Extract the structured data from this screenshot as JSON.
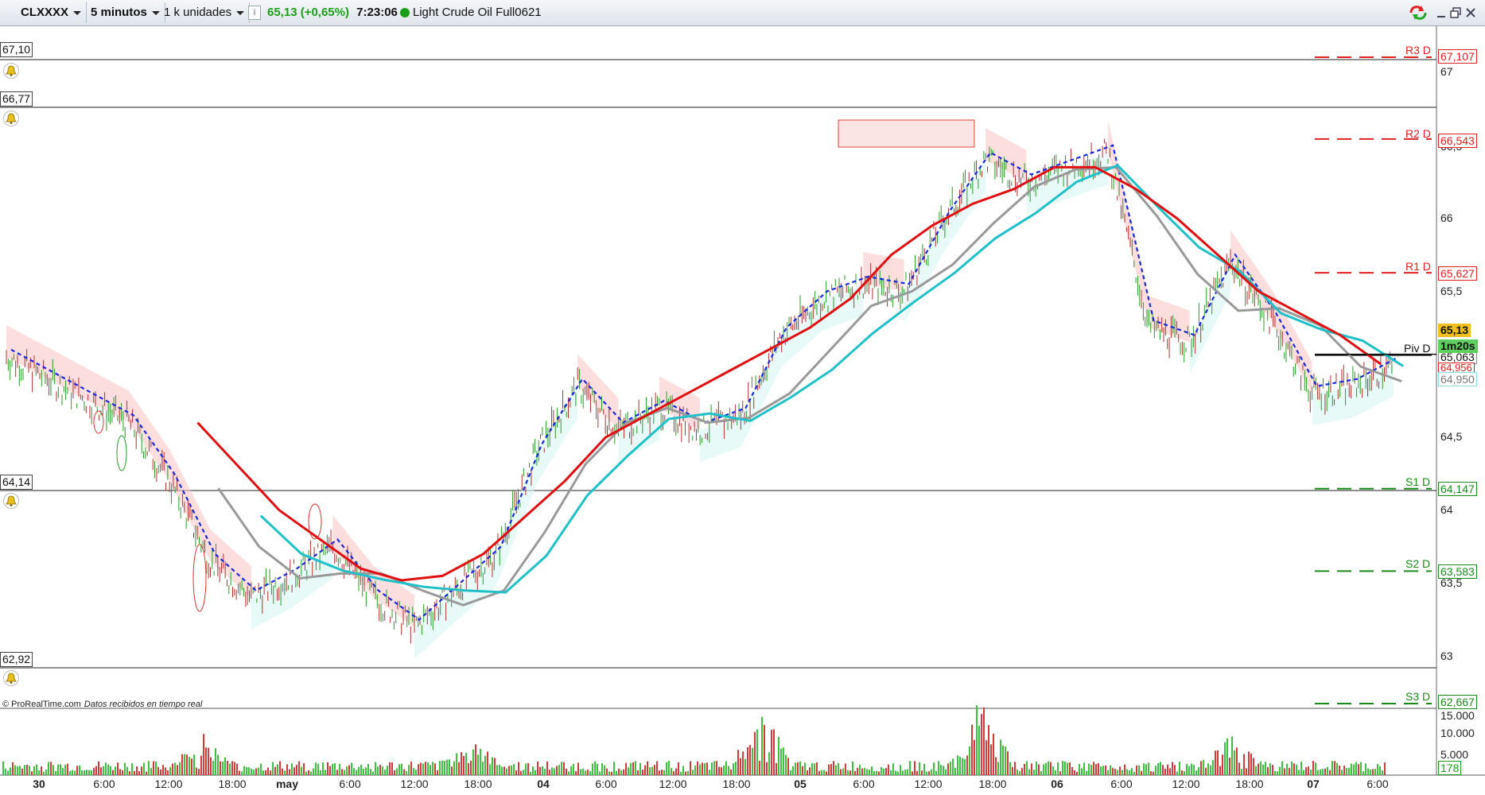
{
  "toolbar": {
    "symbol": "CLXXXX",
    "timeframe": "5 minutos",
    "units": "1 k unidades",
    "info_icon": "info-icon",
    "price_change": "65,13 (+0,65%)",
    "time": "7:23:06",
    "status_dot": "green-status-dot",
    "instrument": "Light Crude Oil Full0621",
    "window_icons": [
      "sync-icon",
      "minimize-icon",
      "restore-icon",
      "close-icon"
    ]
  },
  "credit": {
    "source": "© ProRealTime.com",
    "note": "Datos recibidos en tiempo real"
  },
  "alert_levels": [
    "67,10",
    "66,77",
    "64,14",
    "62,92"
  ],
  "current_price": {
    "value": "65,13",
    "countdown": "1m20s"
  },
  "colors": {
    "sma_red": "#e01010",
    "cyan_ma": "#20c0c8",
    "gray_ma": "#999999",
    "dash_blue": "#1a2ad8",
    "resistance": "#e02020",
    "support": "#1a8a1a",
    "price_tag": "#f0c020",
    "countdown_tag": "#5fd05f"
  },
  "chart_data": [
    {
      "type": "line",
      "title": "",
      "x_tick_labels": [
        "30",
        "6:00",
        "12:00",
        "18:00",
        "may",
        "6:00",
        "12:00",
        "18:00",
        "04",
        "6:00",
        "12:00",
        "18:00",
        "05",
        "6:00",
        "12:00",
        "18:00",
        "06",
        "6:00",
        "12:00",
        "18:00",
        "07",
        "6:00"
      ],
      "y_tick_labels": [
        "67",
        "66,5",
        "66",
        "65,5",
        "65",
        "64,5",
        "64",
        "63,5",
        "63"
      ],
      "ylim": [
        62.9,
        67.15
      ],
      "pivots": [
        {
          "label": "R3 D",
          "value": "67,107"
        },
        {
          "label": "R2 D",
          "value": "66,543"
        },
        {
          "label": "R1 D",
          "value": "65,627"
        },
        {
          "label": "Piv D",
          "value": "65,063"
        },
        {
          "label": "S1 D",
          "value": "64,147"
        },
        {
          "label": "S2 D",
          "value": "63,583"
        },
        {
          "label": "S3 D",
          "value": "62,667"
        }
      ],
      "extra_tags": [
        "64,950",
        "64,956"
      ],
      "series": [
        {
          "x": [
            0,
            6,
            12,
            18,
            24,
            30,
            36,
            42,
            48,
            54,
            60,
            66,
            72,
            78,
            84,
            90,
            96,
            102,
            108,
            114,
            120,
            126,
            132,
            138,
            144,
            150,
            156,
            162,
            168,
            174,
            180,
            186,
            192,
            198,
            204
          ],
          "values": [
            65.05,
            64.9,
            64.75,
            64.6,
            64.2,
            63.65,
            63.4,
            63.55,
            63.75,
            63.4,
            63.2,
            63.45,
            63.7,
            64.4,
            64.85,
            64.55,
            64.7,
            64.55,
            64.65,
            65.2,
            65.45,
            65.55,
            65.5,
            66.0,
            66.4,
            66.25,
            66.35,
            66.45,
            65.25,
            65.15,
            65.7,
            65.3,
            64.8,
            64.85,
            65.0
          ]
        },
        {
          "name": "",
          "x": [
            30,
            36,
            42,
            48,
            54,
            60,
            66,
            72,
            78,
            84,
            90,
            96,
            102,
            108,
            114,
            120,
            126,
            132,
            138,
            144,
            150,
            156,
            162,
            168,
            174,
            180,
            186,
            192,
            198,
            204
          ],
          "values": [
            64.6,
            64.3,
            64.0,
            63.8,
            63.6,
            63.52,
            63.55,
            63.7,
            63.95,
            64.2,
            64.5,
            64.65,
            64.8,
            64.95,
            65.1,
            65.25,
            65.45,
            65.75,
            65.95,
            66.1,
            66.2,
            66.35,
            66.35,
            66.2,
            66.0,
            65.75,
            65.5,
            65.35,
            65.2,
            65.0
          ]
        }
      ]
    },
    {
      "type": "bar",
      "title": "",
      "y_tick_labels": [
        "15.000",
        "10.000",
        "5.000"
      ],
      "last_value": "178"
    }
  ]
}
